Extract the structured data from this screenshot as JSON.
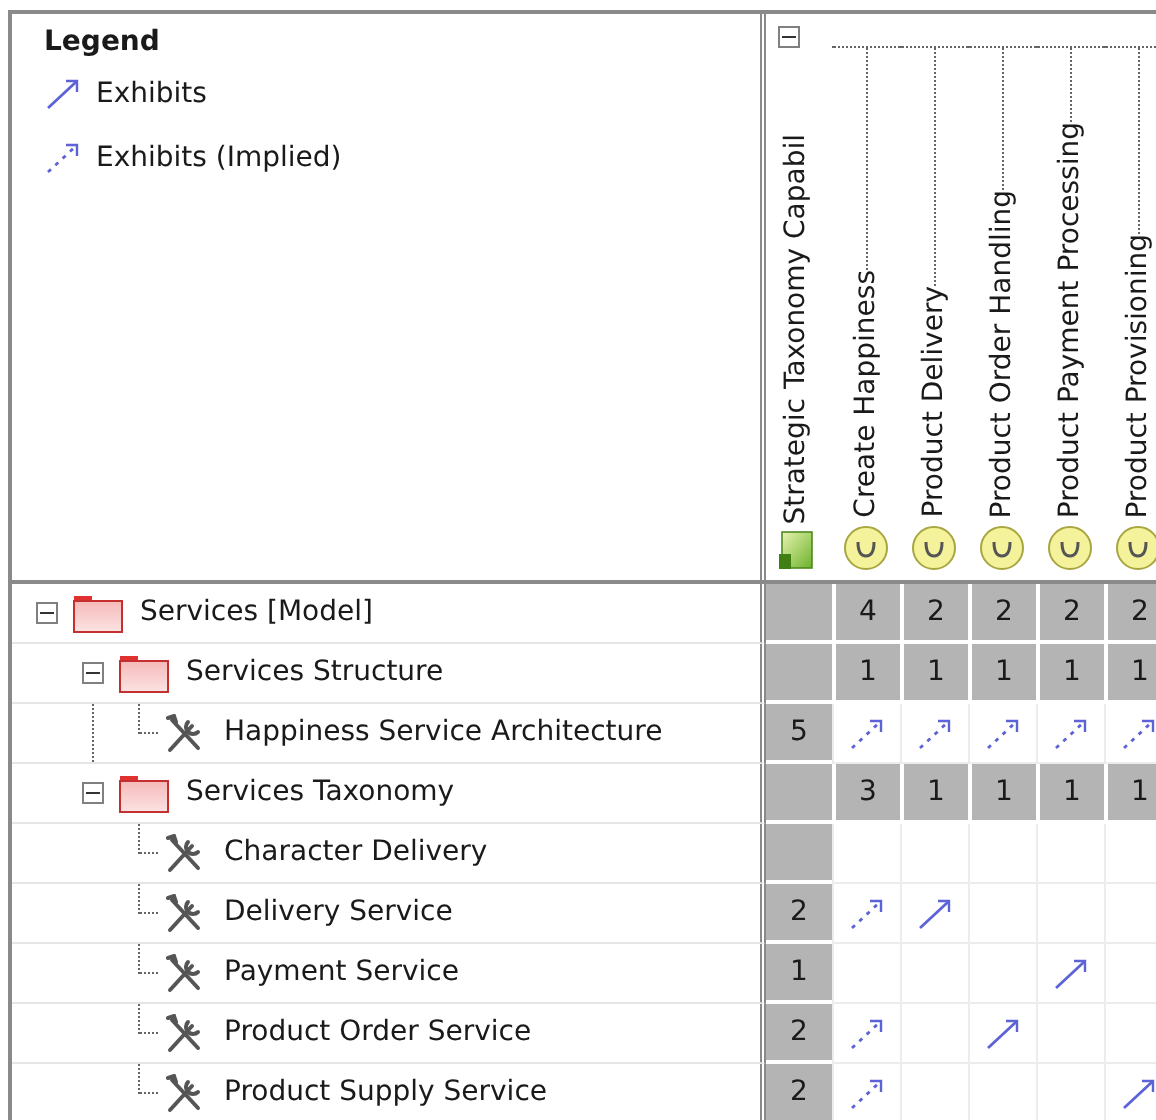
{
  "legend": {
    "title": "Legend",
    "items": [
      {
        "kind": "exhibits",
        "label": "Exhibits"
      },
      {
        "kind": "implied",
        "label": "Exhibits (Implied)"
      }
    ]
  },
  "columns": {
    "expanded": true,
    "group": {
      "label": "Strategic Taxonomy Capabil"
    },
    "items": [
      {
        "label": "Create Happiness"
      },
      {
        "label": "Product Delivery"
      },
      {
        "label": "Product Order Handling"
      },
      {
        "label": "Product Payment Processing"
      },
      {
        "label": "Product Provisioning"
      }
    ]
  },
  "rows": [
    {
      "label": "Services [Model]",
      "kind": "package",
      "expanded": true,
      "cells": [
        {
          "kind": "count",
          "text": "4"
        },
        {
          "kind": "count",
          "text": "2"
        },
        {
          "kind": "count",
          "text": "2"
        },
        {
          "kind": "count",
          "text": "2"
        },
        {
          "kind": "count",
          "text": "2"
        }
      ],
      "children": [
        {
          "label": "Services Structure",
          "kind": "package",
          "expanded": true,
          "cells": [
            {
              "kind": "count",
              "text": "1"
            },
            {
              "kind": "count",
              "text": "1"
            },
            {
              "kind": "count",
              "text": "1"
            },
            {
              "kind": "count",
              "text": "1"
            },
            {
              "kind": "count",
              "text": "1"
            }
          ],
          "children": [
            {
              "label": "Happiness Service Architecture",
              "kind": "service",
              "total": "5",
              "cells": [
                {
                  "kind": "implied"
                },
                {
                  "kind": "implied"
                },
                {
                  "kind": "implied"
                },
                {
                  "kind": "implied"
                },
                {
                  "kind": "implied"
                }
              ]
            }
          ]
        },
        {
          "label": "Services Taxonomy",
          "kind": "package",
          "expanded": true,
          "cells": [
            {
              "kind": "count",
              "text": "3"
            },
            {
              "kind": "count",
              "text": "1"
            },
            {
              "kind": "count",
              "text": "1"
            },
            {
              "kind": "count",
              "text": "1"
            },
            {
              "kind": "count",
              "text": "1"
            }
          ],
          "children": [
            {
              "label": "Character Delivery",
              "kind": "service",
              "cells": [
                {
                  "kind": "blank"
                },
                {
                  "kind": "blank"
                },
                {
                  "kind": "blank"
                },
                {
                  "kind": "blank"
                },
                {
                  "kind": "blank"
                }
              ]
            },
            {
              "label": "Delivery Service",
              "kind": "service",
              "total": "2",
              "cells": [
                {
                  "kind": "implied"
                },
                {
                  "kind": "exhibits"
                },
                {
                  "kind": "blank"
                },
                {
                  "kind": "blank"
                },
                {
                  "kind": "blank"
                }
              ]
            },
            {
              "label": "Payment Service",
              "kind": "service",
              "total": "1",
              "cells": [
                {
                  "kind": "blank"
                },
                {
                  "kind": "blank"
                },
                {
                  "kind": "blank"
                },
                {
                  "kind": "exhibits"
                },
                {
                  "kind": "blank"
                }
              ]
            },
            {
              "label": "Product Order Service",
              "kind": "service",
              "total": "2",
              "cells": [
                {
                  "kind": "implied"
                },
                {
                  "kind": "blank"
                },
                {
                  "kind": "exhibits"
                },
                {
                  "kind": "blank"
                },
                {
                  "kind": "blank"
                }
              ]
            },
            {
              "label": "Product Supply Service",
              "kind": "service",
              "total": "2",
              "cells": [
                {
                  "kind": "implied"
                },
                {
                  "kind": "blank"
                },
                {
                  "kind": "blank"
                },
                {
                  "kind": "blank"
                },
                {
                  "kind": "exhibits"
                }
              ]
            }
          ]
        }
      ]
    }
  ]
}
